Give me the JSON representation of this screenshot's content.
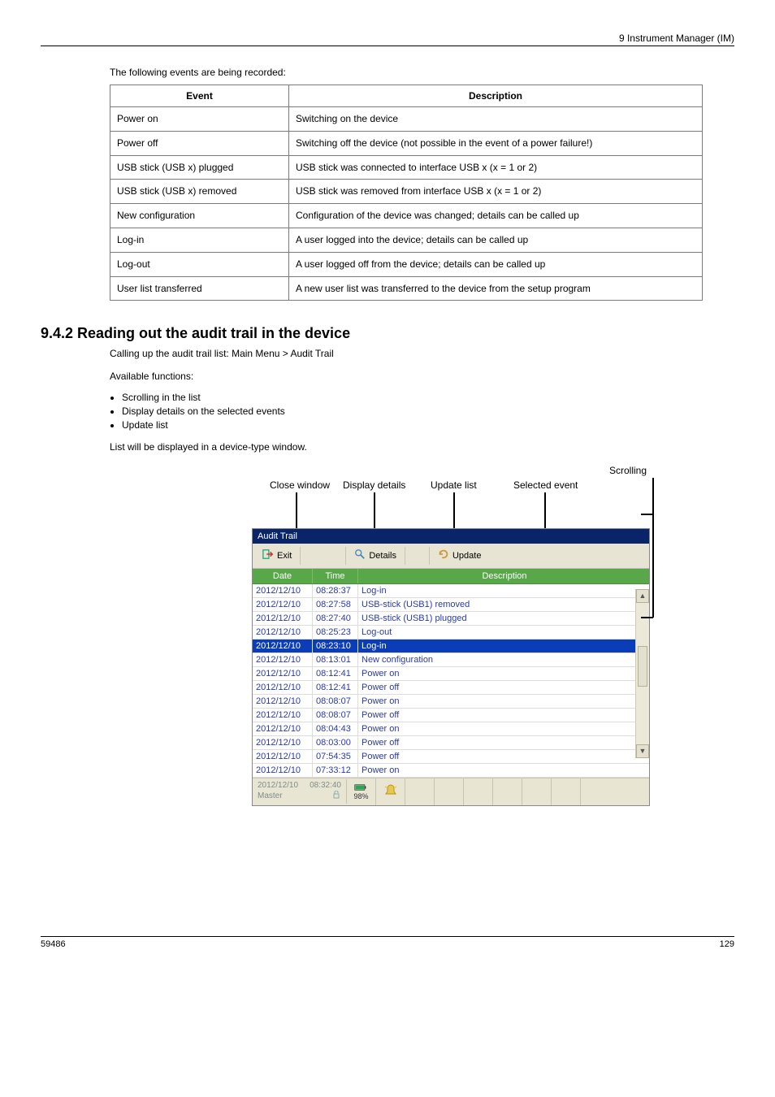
{
  "header": {
    "left": "",
    "right": "9 Instrument Manager (IM)"
  },
  "intro": "The following events are being recorded:",
  "events": [
    {
      "name": "Power on",
      "desc": "Switching on the device"
    },
    {
      "name": "Power off",
      "desc": "Switching off the device (not possible in the event of a power failure!)"
    },
    {
      "name": "USB stick (USB x) plugged",
      "desc": "USB stick was connected to interface USB x (x = 1 or 2)"
    },
    {
      "name": "USB stick (USB x) removed",
      "desc": "USB stick was removed from interface USB x (x = 1 or 2)"
    },
    {
      "name": "New configuration",
      "desc": "Configuration of the device was changed; details can be called up"
    },
    {
      "name": "Log-in",
      "desc": "A user logged into the device; details can be called up"
    },
    {
      "name": "Log-out",
      "desc": "A user logged off from the device; details can be called up"
    },
    {
      "name": "User list transferred",
      "desc": "A new user list was transferred to the device from the setup program"
    }
  ],
  "section": {
    "title": "9.4.2 Reading out the audit trail in the device",
    "p1": "Calling up the audit trail list: Main Menu > Audit Trail",
    "p2": "Available functions:",
    "bullets": [
      "Scrolling in the list",
      "Display details on the selected events",
      "Update list"
    ],
    "p3": "List will be displayed in a device-type window."
  },
  "callouts": {
    "c1": "Close window",
    "c2": "Display details",
    "c3": "Update list",
    "c4": "Selected event",
    "c5": "Scrolling"
  },
  "app": {
    "title": "Audit Trail",
    "toolbar": {
      "exit": "Exit",
      "details": "Details",
      "update": "Update"
    },
    "columns": {
      "date": "Date",
      "time": "Time",
      "desc": "Description"
    },
    "rows": [
      {
        "date": "2012/12/10",
        "time": "08:28:37",
        "desc": "Log-in"
      },
      {
        "date": "2012/12/10",
        "time": "08:27:58",
        "desc": "USB-stick (USB1) removed"
      },
      {
        "date": "2012/12/10",
        "time": "08:27:40",
        "desc": "USB-stick (USB1) plugged"
      },
      {
        "date": "2012/12/10",
        "time": "08:25:23",
        "desc": "Log-out"
      },
      {
        "date": "2012/12/10",
        "time": "08:23:10",
        "desc": "Log-in",
        "selected": true
      },
      {
        "date": "2012/12/10",
        "time": "08:13:01",
        "desc": "New configuration"
      },
      {
        "date": "2012/12/10",
        "time": "08:12:41",
        "desc": "Power on"
      },
      {
        "date": "2012/12/10",
        "time": "08:12:41",
        "desc": "Power off"
      },
      {
        "date": "2012/12/10",
        "time": "08:08:07",
        "desc": "Power on"
      },
      {
        "date": "2012/12/10",
        "time": "08:08:07",
        "desc": "Power off"
      },
      {
        "date": "2012/12/10",
        "time": "08:04:43",
        "desc": "Power on"
      },
      {
        "date": "2012/12/10",
        "time": "08:03:00",
        "desc": "Power off"
      },
      {
        "date": "2012/12/10",
        "time": "07:54:35",
        "desc": "Power off"
      },
      {
        "date": "2012/12/10",
        "time": "07:33:12",
        "desc": "Power on"
      }
    ],
    "status": {
      "date": "2012/12/10",
      "time": "08:32:40",
      "user": "Master",
      "battery": "98%"
    }
  },
  "footer": {
    "left": "59486",
    "right": "129"
  }
}
